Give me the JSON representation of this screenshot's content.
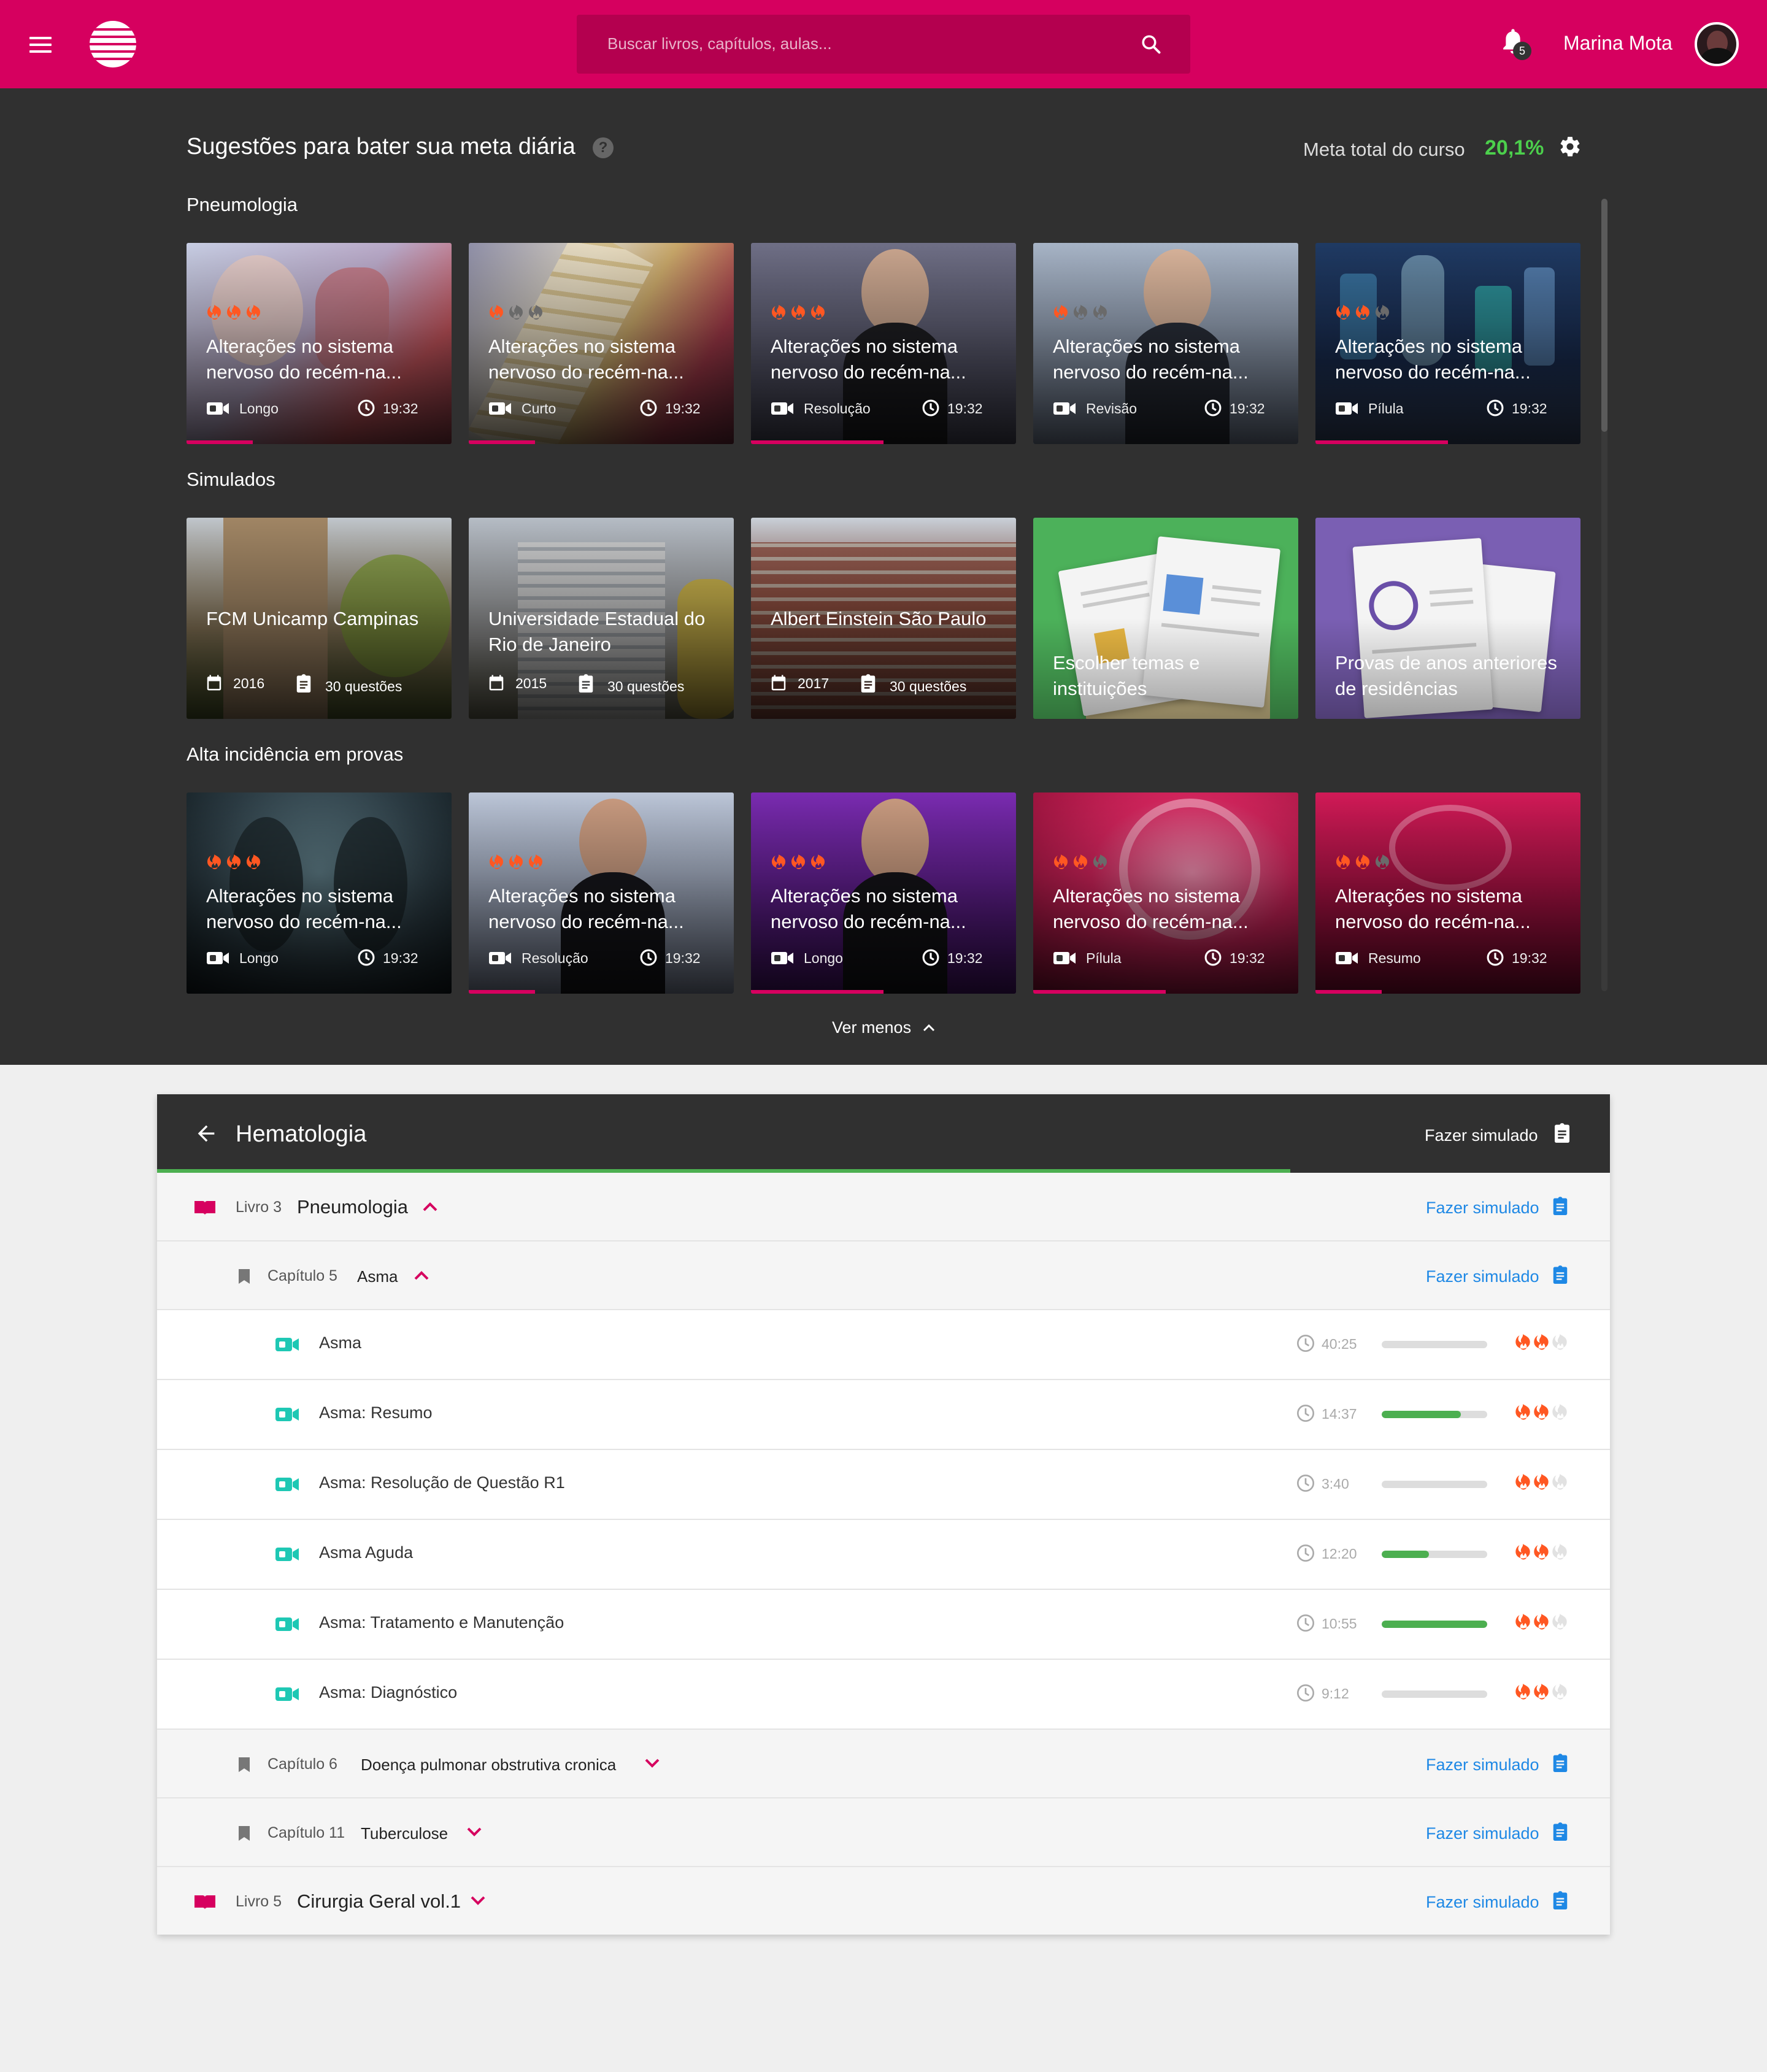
{
  "header": {
    "search_placeholder": "Buscar livros, capítulos, aulas...",
    "notifications": "5",
    "user_name": "Marina Mota",
    "brand_color": "#d6005f"
  },
  "suggestions": {
    "title": "Sugestões para bater sua meta diária",
    "help": "?",
    "meta_label": "Meta total do curso",
    "meta_value": "20,1%",
    "ver_menos": "Ver menos"
  },
  "sections": [
    {
      "label": "Pneumologia",
      "cards": [
        {
          "title": "Alterações no sistema nervoso do recém-na...",
          "type": "Longo",
          "time": "19:32",
          "flames": 3,
          "progress": 0.25
        },
        {
          "title": "Alterações no sistema nervoso do recém-na...",
          "type": "Curto",
          "time": "19:32",
          "flames": 1,
          "progress": 0.25
        },
        {
          "title": "Alterações no sistema nervoso do recém-na...",
          "type": "Resolução",
          "time": "19:32",
          "flames": 3,
          "progress": 0.5
        },
        {
          "title": "Alterações no sistema nervoso do recém-na...",
          "type": "Revisão",
          "time": "19:32",
          "flames": 1,
          "progress": 0
        },
        {
          "title": "Alterações no sistema nervoso do recém-na...",
          "type": "Pílula",
          "time": "19:32",
          "flames": 2,
          "progress": 0.5
        }
      ]
    },
    {
      "label": "Simulados",
      "cards": [
        {
          "title": "FCM Unicamp Campinas",
          "year": "2016",
          "questions": "30 questões"
        },
        {
          "title": "Universidade Estadual do Rio de Janeiro",
          "year": "2015",
          "questions": "30 questões"
        },
        {
          "title": "Albert Einstein São Paulo",
          "year": "2017",
          "questions": "30 questões"
        },
        {
          "title": "Escolher temas e instituições"
        },
        {
          "title": "Provas de anos anteriores de residências"
        }
      ]
    },
    {
      "label": "Alta incidência em provas",
      "cards": [
        {
          "title": "Alterações no sistema nervoso do recém-na...",
          "type": "Longo",
          "time": "19:32",
          "flames": 3,
          "progress": 0
        },
        {
          "title": "Alterações no sistema nervoso do recém-na...",
          "type": "Resolução",
          "time": "19:32",
          "flames": 3,
          "progress": 0.25
        },
        {
          "title": "Alterações no sistema nervoso do recém-na...",
          "type": "Longo",
          "time": "19:32",
          "flames": 3,
          "progress": 0.5
        },
        {
          "title": "Alterações no sistema nervoso do recém-na...",
          "type": "Pílula",
          "time": "19:32",
          "flames": 2,
          "progress": 0.5
        },
        {
          "title": "Alterações no sistema nervoso do recém-na...",
          "type": "Resumo",
          "time": "19:32",
          "flames": 2,
          "progress": 0.25
        }
      ]
    }
  ],
  "hematologia": {
    "title": "Hematologia",
    "fazer_simulado": "Fazer simulado",
    "progress": 0.78,
    "livro3": {
      "prefix": "Livro 3",
      "name": "Pneumologia"
    },
    "cap5": {
      "prefix": "Capítulo 5",
      "name": "Asma"
    },
    "lessons": [
      {
        "name": "Asma",
        "time": "40:25",
        "progress": 0,
        "flames": 2
      },
      {
        "name": "Asma: Resumo",
        "time": "14:37",
        "progress": 0.75,
        "flames": 2
      },
      {
        "name": "Asma: Resolução de Questão R1",
        "time": "3:40",
        "progress": 0,
        "flames": 2
      },
      {
        "name": "Asma Aguda",
        "time": "12:20",
        "progress": 0.45,
        "flames": 2
      },
      {
        "name": "Asma: Tratamento e Manutenção",
        "time": "10:55",
        "progress": 1,
        "flames": 2
      },
      {
        "name": "Asma: Diagnóstico",
        "time": "9:12",
        "progress": 0,
        "flames": 2
      }
    ],
    "cap6": {
      "prefix": "Capítulo 6",
      "name": "Doença pulmonar obstrutiva cronica"
    },
    "cap11": {
      "prefix": "Capítulo 11",
      "name": "Tuberculose"
    },
    "livro5": {
      "prefix": "Livro 5",
      "name": "Cirurgia Geral vol.1"
    }
  },
  "colors": {
    "accent": "#d6005f",
    "success": "#4caf50",
    "link": "#1e88e5",
    "flame": "#ff5722",
    "teal": "#1ec8b4"
  }
}
